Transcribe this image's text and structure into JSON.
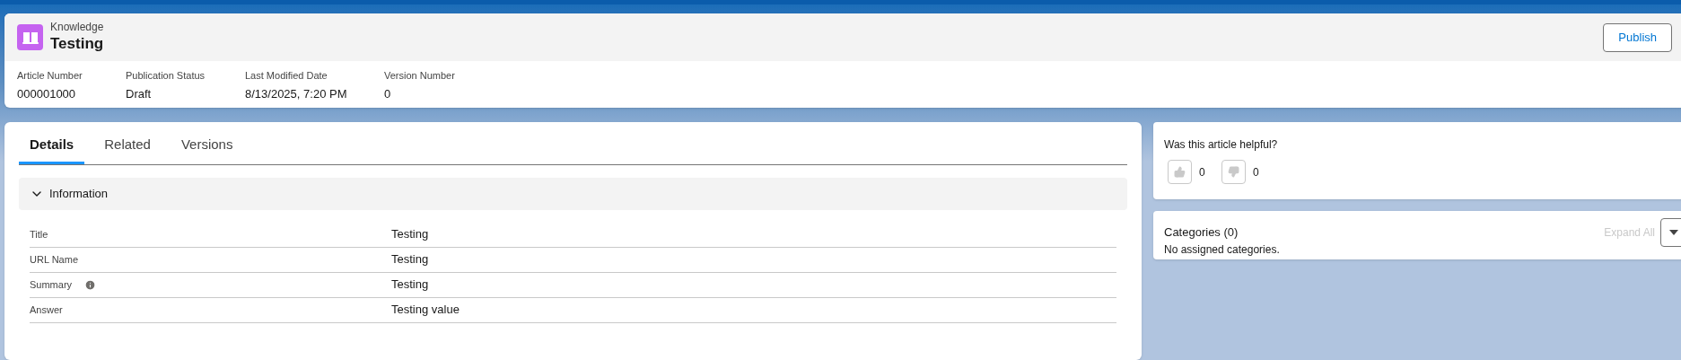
{
  "header": {
    "object_type": "Knowledge",
    "title": "Testing",
    "action_button": "Publish",
    "fields": [
      {
        "label": "Article Number",
        "value": "000001000"
      },
      {
        "label": "Publication Status",
        "value": "Draft"
      },
      {
        "label": "Last Modified Date",
        "value": "8/13/2025, 7:20 PM"
      },
      {
        "label": "Version Number",
        "value": "0"
      }
    ]
  },
  "tabs": [
    {
      "label": "Details",
      "selected": true
    },
    {
      "label": "Related",
      "selected": false
    },
    {
      "label": "Versions",
      "selected": false
    }
  ],
  "section": {
    "title": "Information",
    "expanded": true,
    "rows": [
      {
        "label": "Title",
        "value": "Testing",
        "help": false
      },
      {
        "label": "URL Name",
        "value": "Testing",
        "help": false
      },
      {
        "label": "Summary",
        "value": "Testing",
        "help": true
      },
      {
        "label": "Answer",
        "value": "Testing value",
        "help": false
      }
    ]
  },
  "feedback": {
    "question": "Was this article helpful?",
    "up_count": "0",
    "down_count": "0"
  },
  "categories": {
    "title": "Categories (0)",
    "expand_all": "Expand All",
    "empty_message": "No assigned categories."
  }
}
